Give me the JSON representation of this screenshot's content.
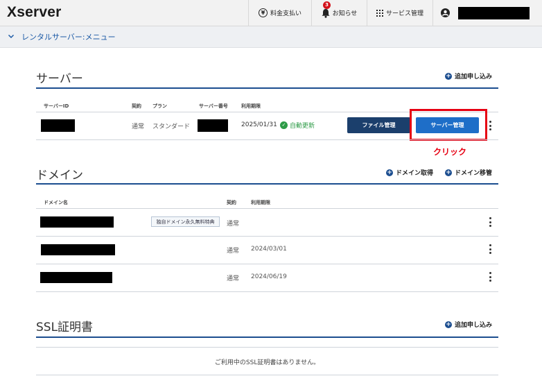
{
  "header": {
    "logo": "Xserver",
    "billing": "料金支払い",
    "notifications": "お知らせ",
    "notification_count": "3",
    "service_management": "サービス管理"
  },
  "menu": {
    "label": "レンタルサーバー:メニュー"
  },
  "server": {
    "title": "サーバー",
    "add_label": "追加申し込み",
    "headers": {
      "id": "サーバーID",
      "contract": "契約",
      "plan": "プラン",
      "number": "サーバー番号",
      "expiry": "利用期限"
    },
    "row": {
      "contract": "通常",
      "plan": "スタンダード",
      "expiry": "2025/01/31",
      "renew": "自動更新",
      "file_button": "ファイル管理",
      "server_button": "サーバー管理"
    },
    "annotation": "クリック"
  },
  "domain": {
    "title": "ドメイン",
    "acquire_label": "ドメイン取得",
    "transfer_label": "ドメイン移管",
    "headers": {
      "name": "ドメイン名",
      "contract": "契約",
      "expiry": "利用期限"
    },
    "rows": [
      {
        "tag": "独自ドメイン永久無料特典",
        "contract": "通常",
        "expiry": ""
      },
      {
        "tag": "",
        "contract": "通常",
        "expiry": "2024/03/01"
      },
      {
        "tag": "",
        "contract": "通常",
        "expiry": "2024/06/19"
      }
    ]
  },
  "ssl": {
    "title": "SSL証明書",
    "add_label": "追加申し込み",
    "empty_message": "ご利用中のSSL証明書はありません。"
  },
  "colors": {
    "accent": "#1b4d8f",
    "button_primary": "#1e6ec8",
    "button_dark": "#1b3f6c",
    "highlight": "#e60012",
    "renew": "#2e9b47"
  }
}
